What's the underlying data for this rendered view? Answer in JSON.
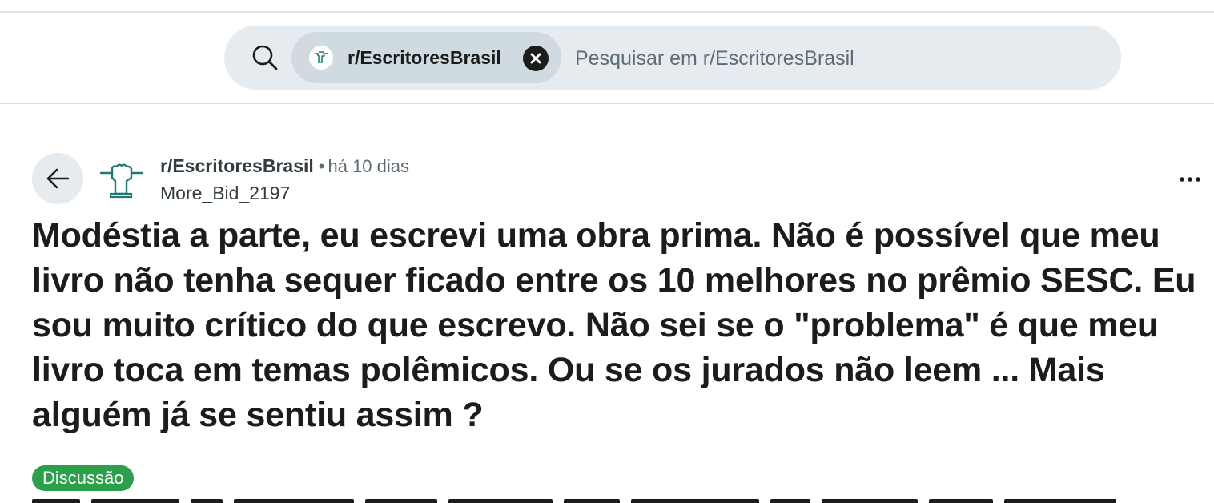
{
  "header": {
    "search": {
      "icon": "search-icon",
      "chip_label": "r/EscritoresBrasil",
      "chip_icon": "subreddit-avatar-icon",
      "clear_icon": "close-icon",
      "placeholder": "Pesquisar em r/EscritoresBrasil"
    }
  },
  "post": {
    "back_icon": "arrow-left-icon",
    "subreddit": "r/EscritoresBrasil",
    "separator": "•",
    "time_ago": "há 10 dias",
    "author": "More_Bid_2197",
    "more_icon": "more-horizontal-icon",
    "title": "Modéstia a parte, eu escrevi uma obra prima. Não é possível que meu livro não tenha sequer ficado entre os 10 melhores no prêmio SESC. Eu sou muito crítico do que escrevo. Não sei se o \"problema\" é que meu livro toca em temas polêmicos. Ou se os jurados não leem ... Mais alguém já se sentiu assim ?",
    "flair": "Discussão"
  },
  "colors": {
    "search_bg": "#e5ebee",
    "chip_bg": "#cfdbe1",
    "flair_bg": "#2c9f4a",
    "text": "#1c1c1c",
    "meta_text": "#5c6c74",
    "avatar_accent": "#1f7a74"
  }
}
